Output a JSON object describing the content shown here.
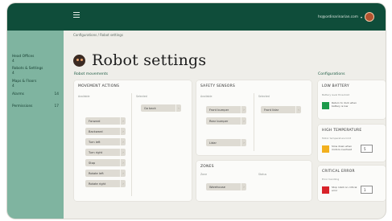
{
  "header": {
    "user_email": "hs@ordinarinarian.com"
  },
  "breadcrumb": "Configurations / Robot settings",
  "sidebar": {
    "items": [
      {
        "label": "Head Offices",
        "count": "4"
      },
      {
        "label": "Robots & Settings",
        "count": "4"
      },
      {
        "label": "Maps & Floors",
        "count": "4"
      },
      {
        "label": "Alarms",
        "count": "14"
      },
      {
        "label": "Permissions",
        "count": "17"
      }
    ]
  },
  "page": {
    "title": "Robot settings",
    "left_section": "Robot movements",
    "right_section": "Configurations"
  },
  "movements_card": {
    "title": "MOVEMENT ACTIONS",
    "col_available": "Available",
    "col_selected": "Selected",
    "available": [
      "Forward",
      "Backward",
      "Turn left",
      "Turn right",
      "Stop",
      "Rotate left",
      "Rotate right"
    ],
    "selected": [
      "Go back"
    ]
  },
  "sensor_card": {
    "title": "SAFETY SENSORS",
    "col_available": "Available",
    "col_selected": "Selected",
    "available": [
      "Front bumper",
      "Rear bumper",
      "Lidar"
    ],
    "selected": [
      "Front lidar"
    ]
  },
  "zone_card": {
    "title": "ZONES",
    "col_zone": "Zone",
    "col_status": "Status",
    "items": [
      "Warehouse"
    ]
  },
  "config_cards": [
    {
      "title": "LOW BATTERY",
      "sub": "Battery level threshold",
      "color": "#1c9a4a",
      "text": "Return to dock when battery is low",
      "value": ""
    },
    {
      "title": "HIGH TEMPERATURE",
      "sub": "Motor temperature limit",
      "color": "#f2b01e",
      "text": "Slow down when motors overheat",
      "value": "5"
    },
    {
      "title": "CRITICAL ERROR",
      "sub": "Error handling",
      "color": "#d8232a",
      "text": "Stop robot on critical error",
      "value": "1"
    }
  ]
}
